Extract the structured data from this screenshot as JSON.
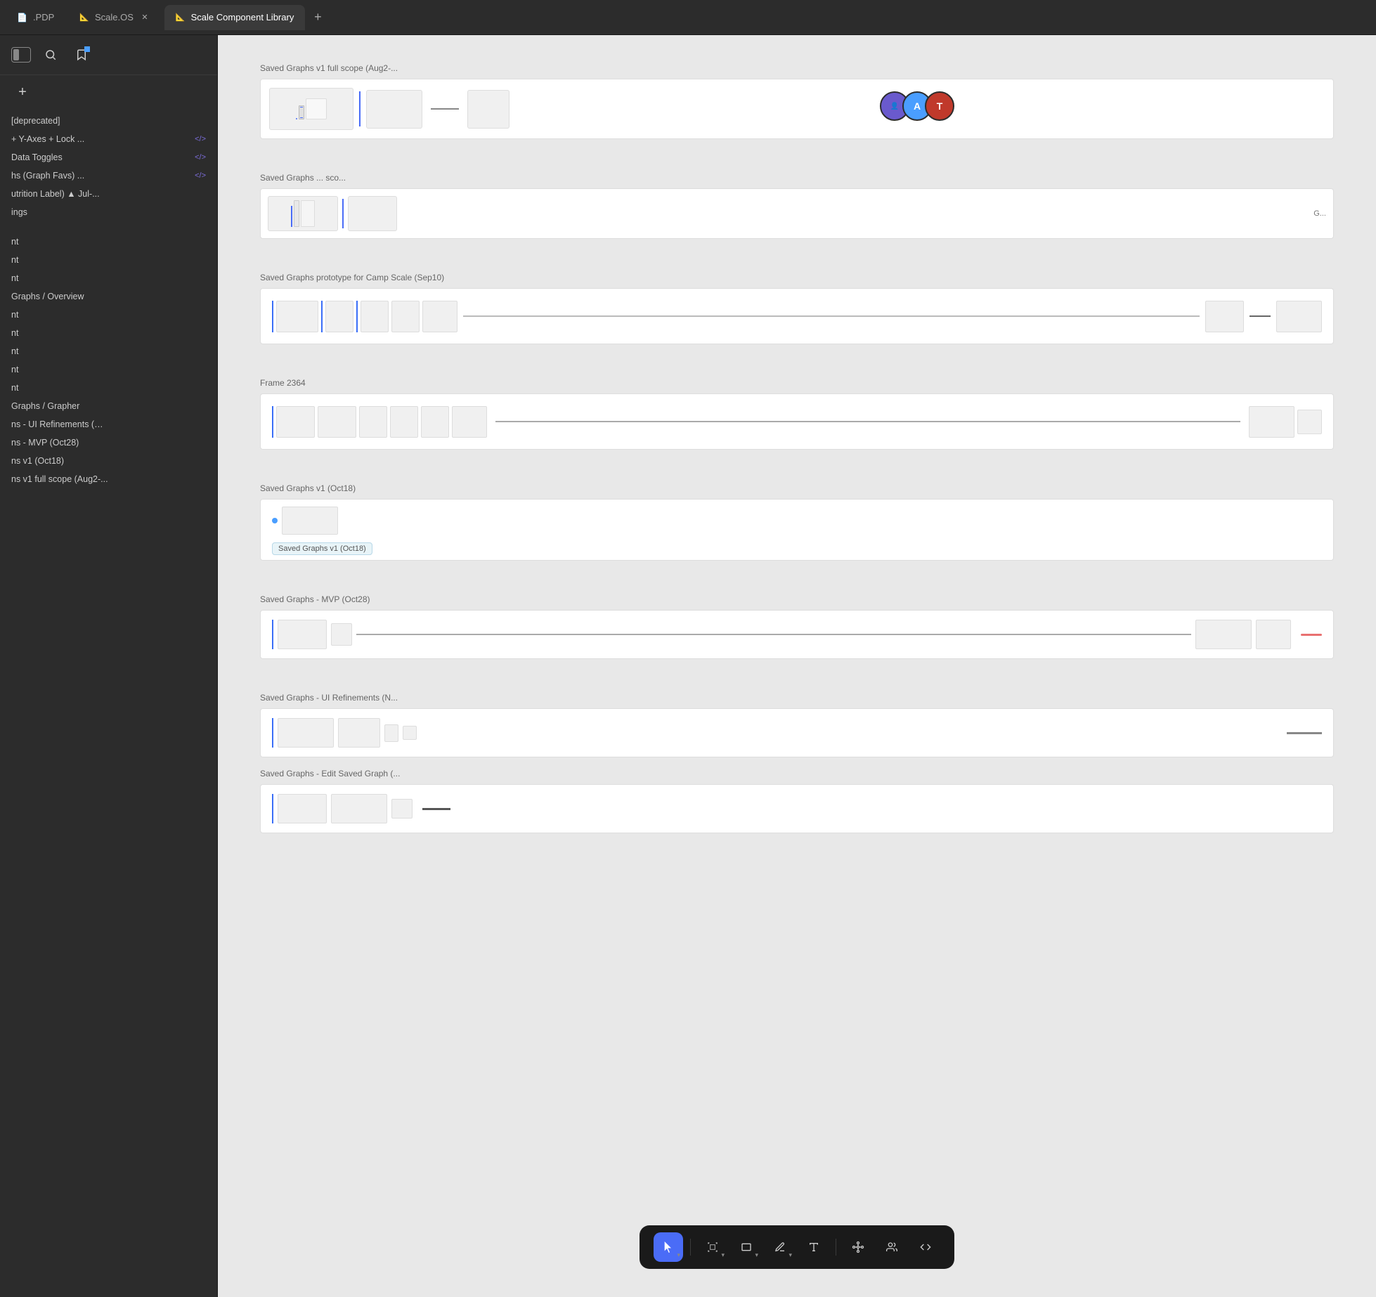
{
  "tabs": [
    {
      "id": "pdp",
      "label": ".PDP",
      "icon": "document",
      "active": false,
      "closable": false
    },
    {
      "id": "scaleos",
      "label": "Scale.OS",
      "icon": "document",
      "active": false,
      "closable": true
    },
    {
      "id": "scale-component-library",
      "label": "Scale Component Library",
      "icon": "document",
      "active": true,
      "closable": false
    }
  ],
  "tab_add_label": "+",
  "sidebar": {
    "items": [
      {
        "id": "deprecated",
        "label": "[deprecated]",
        "code": null
      },
      {
        "id": "y-axes-lock",
        "label": "+ Y-Axes + Lock ...",
        "code": "</>",
        "code_color": "purple"
      },
      {
        "id": "data-toggles",
        "label": "Data Toggles",
        "code": "</>",
        "code_color": "purple"
      },
      {
        "id": "graph-favs",
        "label": "hs (Graph Favs) ...",
        "code": "</>",
        "code_color": "purple"
      },
      {
        "id": "nutrition-label",
        "label": "utrition Label) ▲ Jul-...",
        "code": null
      },
      {
        "id": "ings",
        "label": "ings",
        "code": null
      },
      {
        "id": "sep1",
        "label": "",
        "code": null
      },
      {
        "id": "nt1",
        "label": "nt",
        "code": null
      },
      {
        "id": "nt2",
        "label": "nt",
        "code": null
      },
      {
        "id": "nt3",
        "label": "nt",
        "code": null
      },
      {
        "id": "graphs-overview",
        "label": "Graphs / Overview",
        "code": null
      },
      {
        "id": "nt4",
        "label": "nt",
        "code": null
      },
      {
        "id": "nt5",
        "label": "nt",
        "code": null
      },
      {
        "id": "nt6",
        "label": "nt",
        "code": null
      },
      {
        "id": "nt7",
        "label": "nt",
        "code": null
      },
      {
        "id": "nt8",
        "label": "nt",
        "code": null
      },
      {
        "id": "graphs-grapher",
        "label": "Graphs / Grapher",
        "code": null
      },
      {
        "id": "ui-refinements",
        "label": "ns - UI Refinements (…",
        "code": null
      },
      {
        "id": "mvp-oct28",
        "label": "ns - MVP (Oct28)",
        "code": null
      },
      {
        "id": "v1-oct18",
        "label": "ns v1 (Oct18)",
        "code": null
      },
      {
        "id": "v1-full-scope",
        "label": "ns v1 full scope (Aug2-...",
        "code": null
      }
    ]
  },
  "frames": [
    {
      "id": "saved-graphs-v1-full-scope",
      "label": "Saved Graphs v1 full scope (Aug2-...",
      "has_content": true,
      "wide": true
    },
    {
      "id": "saved-graphs-2",
      "label": "Saved Graphs ... sco...",
      "has_content": true,
      "wide": false
    },
    {
      "id": "saved-graphs-prototype",
      "label": "Saved Graphs prototype for Camp Scale (Sep10)",
      "has_content": true,
      "wide": true
    },
    {
      "id": "frame-2364",
      "label": "Frame 2364",
      "has_content": true,
      "wide": true
    },
    {
      "id": "saved-graphs-v1-oct18",
      "label": "Saved Graphs v1 (Oct18)",
      "has_content": true,
      "wide": false
    },
    {
      "id": "saved-graphs-mvp-oct28",
      "label": "Saved Graphs - MVP (Oct28)",
      "has_content": true,
      "wide": false
    },
    {
      "id": "saved-graphs-ui-refinements",
      "label": "Saved Graphs - UI Refinements (N...",
      "has_content": true,
      "wide": false
    },
    {
      "id": "saved-graphs-edit",
      "label": "Saved Graphs - Edit Saved Graph (...",
      "has_content": true,
      "wide": false
    }
  ],
  "avatars": [
    {
      "id": "photo",
      "type": "photo",
      "label": "User Photo"
    },
    {
      "id": "a",
      "type": "letter",
      "letter": "A",
      "color": "#4a9eff"
    },
    {
      "id": "t",
      "type": "letter",
      "letter": "T",
      "color": "#c0392b"
    }
  ],
  "toolbar": {
    "tools": [
      {
        "id": "cursor",
        "icon": "cursor",
        "active": true,
        "has_chevron": true,
        "label": "Cursor tool"
      },
      {
        "id": "frame",
        "icon": "frame",
        "active": false,
        "has_chevron": true,
        "label": "Frame tool"
      },
      {
        "id": "rect",
        "icon": "rectangle",
        "active": false,
        "has_chevron": true,
        "label": "Rectangle tool"
      },
      {
        "id": "pen",
        "icon": "pen",
        "active": false,
        "has_chevron": true,
        "label": "Pen tool"
      },
      {
        "id": "text",
        "icon": "text",
        "active": false,
        "has_chevron": false,
        "label": "Text tool"
      },
      {
        "id": "component",
        "icon": "component",
        "active": false,
        "has_chevron": false,
        "label": "Component tool"
      },
      {
        "id": "layout",
        "icon": "layout",
        "active": false,
        "has_chevron": false,
        "label": "Layout tool"
      },
      {
        "id": "code",
        "icon": "code",
        "active": false,
        "has_chevron": false,
        "label": "Code tool"
      }
    ]
  }
}
